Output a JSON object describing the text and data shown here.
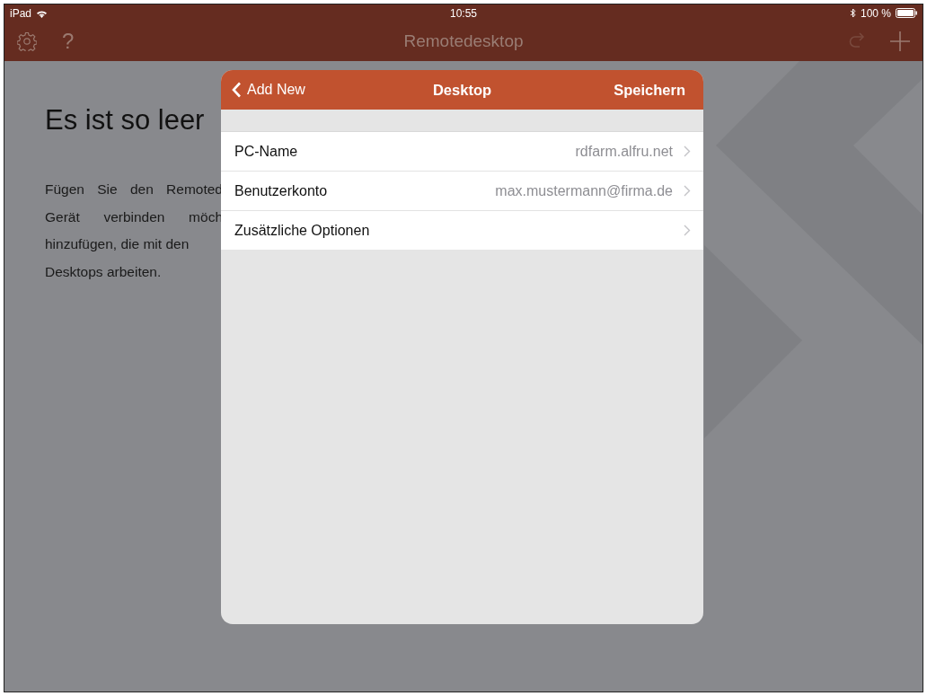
{
  "status_bar": {
    "device": "iPad",
    "time": "10:55",
    "battery": "100 %"
  },
  "nav_bar": {
    "title": "Remotedesktop",
    "help": "?"
  },
  "empty_state": {
    "heading": "Es ist so leer",
    "lines": [
      "Fügen Sie den Remoted",
      "Gerät verbinden möch",
      "hinzufügen, die mit den",
      "Desktops arbeiten."
    ]
  },
  "dialog": {
    "back": "Add New",
    "title": "Desktop",
    "save": "Speichern",
    "rows": [
      {
        "label": "PC-Name",
        "value": "rdfarm.alfru.net"
      },
      {
        "label": "Benutzerkonto",
        "value": "max.mustermann@firma.de"
      },
      {
        "label": "Zusätzliche Optionen"
      }
    ]
  }
}
